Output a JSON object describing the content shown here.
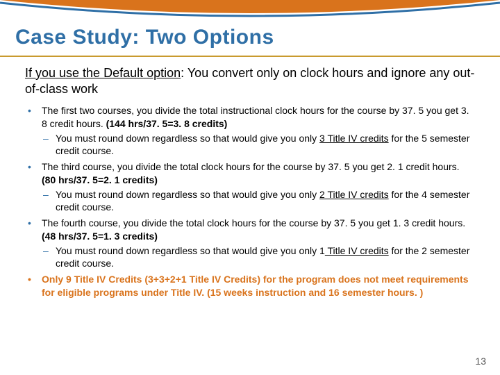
{
  "title": "Case Study:  Two Options",
  "intro_underlined": "If you use the Default option",
  "intro_rest": ": You convert only on clock hours and ignore any out-of-class work",
  "bullets": [
    {
      "main_a": "The first two courses, you divide the total instructional clock hours for the course by 37. 5 you get 3. 8 credit hours.  ",
      "calc": "(144 hrs/37. 5=3. 8 credits)",
      "sub_a": "You must round down regardless so that would give you only ",
      "sub_u": "3 Title IV credits",
      "sub_b": " for the 5 semester credit course."
    },
    {
      "main_a": "The third course, you divide the total clock hours for the course by 37. 5 you get 2. 1 credit hours. ",
      "calc": "(80 hrs/37. 5=2. 1 credits)",
      "sub_a": "You must round down regardless so that would give you only ",
      "sub_u": "2 Title IV credits",
      "sub_b": " for the 4 semester credit course."
    },
    {
      "main_a": "The fourth course, you divide the total clock hours for the course by 37. 5 you get 1. 3 credit hours. ",
      "calc": "(48 hrs/37. 5=1. 3 credits)",
      "sub_a": "You must round down regardless so that would give you only 1",
      "sub_u": " Title IV credits",
      "sub_b": " for the 2 semester credit course."
    }
  ],
  "summary_a": "Only 9 Title IV Credits (3+3+2+1 Title IV Credits) for the program does not meet requirements for eligible programs under Title IV. ",
  "summary_b": "(15 weeks instruction and 16 semester hours. )",
  "page_number": "13"
}
